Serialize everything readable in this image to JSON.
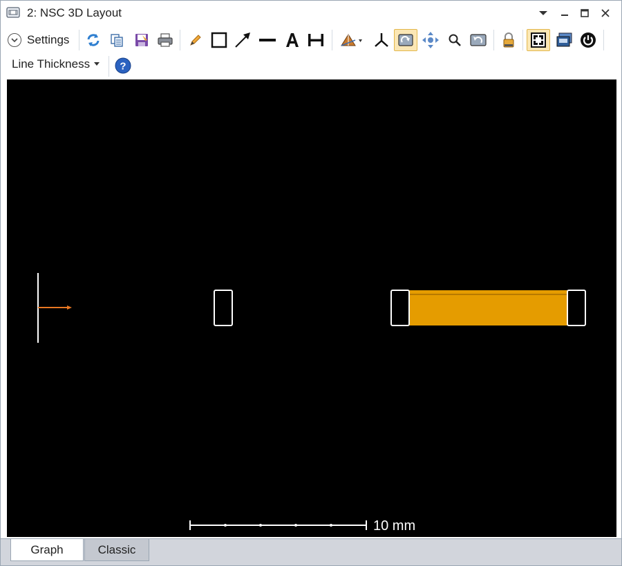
{
  "window": {
    "title": "2: NSC 3D Layout",
    "icon": "layout-window-icon",
    "controls": [
      "dropdown-icon",
      "minimize-icon",
      "maximize-icon",
      "close-icon"
    ]
  },
  "toolbar": {
    "settings_label": "Settings",
    "line_thickness_label": "Line Thickness",
    "buttons": [
      "refresh-icon",
      "copy-icon",
      "save-icon",
      "print-icon",
      "pencil-icon",
      "rectangle-icon",
      "arrow-icon",
      "line-icon",
      "text-icon",
      "dimension-icon",
      "view-angle-icon",
      "axes-icon",
      "rotate-icon",
      "pan-icon",
      "zoom-icon",
      "reset-view-icon",
      "lock-icon",
      "window-layout-icon",
      "export-icon",
      "power-icon",
      "help-icon"
    ]
  },
  "viewer": {
    "background": "#000000",
    "scale_bar_label": "10 mm",
    "ray_color": "#e87722",
    "object_outline_color": "#ffffff",
    "rod_fill_color": "#e59c00"
  },
  "tabs": {
    "graph": "Graph",
    "classic": "Classic"
  }
}
